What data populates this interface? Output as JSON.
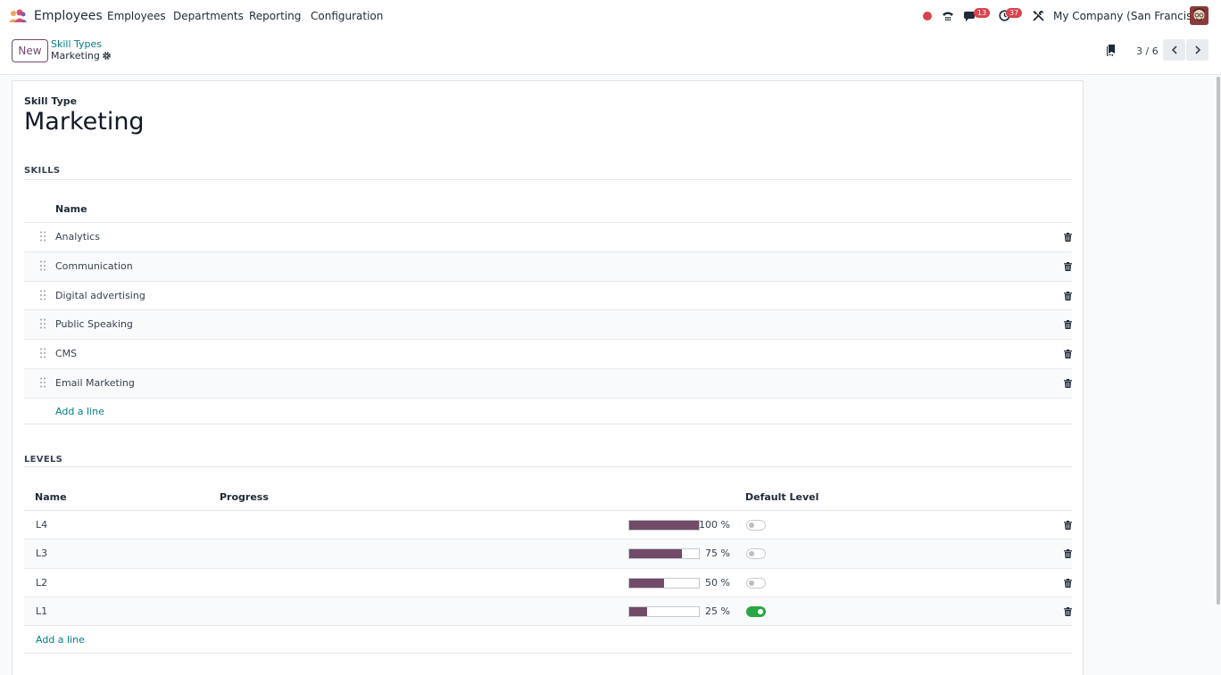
{
  "app": {
    "name": "Employees"
  },
  "menu": [
    "Employees",
    "Departments",
    "Reporting",
    "Configuration"
  ],
  "systray": {
    "messages_count": "13",
    "activities_count": "37",
    "company": "My Company (San Francisco)"
  },
  "control": {
    "new_label": "New",
    "breadcrumb_parent": "Skill Types",
    "breadcrumb_current": "Marketing",
    "pager": "3 / 6"
  },
  "form": {
    "type_label": "Skill Type",
    "name": "Marketing",
    "skills_title": "SKILLS",
    "skills_header": "Name",
    "skills": [
      "Analytics",
      "Communication",
      "Digital advertising",
      "Public Speaking",
      "CMS",
      "Email Marketing"
    ],
    "skills_add": "Add a line",
    "levels_title": "LEVELS",
    "levels_headers": {
      "name": "Name",
      "progress": "Progress",
      "default": "Default Level"
    },
    "levels": [
      {
        "name": "L4",
        "progress": 100,
        "progress_label": "100 %",
        "default": false
      },
      {
        "name": "L3",
        "progress": 75,
        "progress_label": "75 %",
        "default": false
      },
      {
        "name": "L2",
        "progress": 50,
        "progress_label": "50 %",
        "default": false
      },
      {
        "name": "L1",
        "progress": 25,
        "progress_label": "25 %",
        "default": true
      }
    ],
    "levels_add": "Add a line"
  },
  "colors": {
    "brand": "#714B67",
    "link": "#017e84",
    "toggle_on": "#28a745",
    "badge": "#d9434d"
  }
}
